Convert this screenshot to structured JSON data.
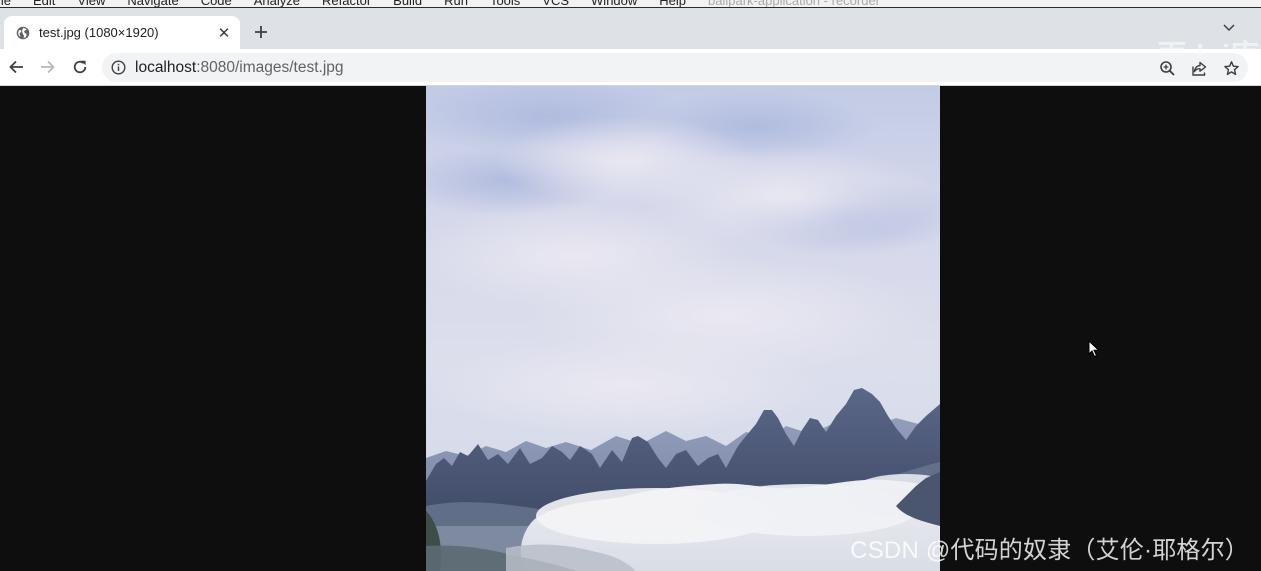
{
  "ide_menu": {
    "items": [
      "ile",
      "Edit",
      "View",
      "Navigate",
      "Code",
      "Analyze",
      "Refactor",
      "Build",
      "Run",
      "Tools",
      "VCS",
      "Window",
      "Help"
    ],
    "faint_text": "ballpark-application - recorder"
  },
  "browser": {
    "tab": {
      "title": "test.jpg (1080×1920)",
      "favicon": "globe-icon",
      "close_glyph": "✕"
    },
    "new_tab_icon": "plus-icon",
    "tab_search_icon": "chevron-down-icon",
    "nav": {
      "back_icon": "back-arrow-icon",
      "forward_icon": "forward-arrow-icon",
      "reload_icon": "reload-icon"
    },
    "address": {
      "host": "localhost",
      "rest": ":8080/images/test.jpg",
      "info_icon": "info-icon"
    },
    "actions": [
      "zoom-icon",
      "share-icon",
      "bookmark-star-icon"
    ]
  },
  "page": {
    "background": "#0e0e0e",
    "image_description_icon": "landscape-photo"
  },
  "overlays": {
    "watermark": "CSDN @代码的奴隶（艾伦·耶格尔）",
    "corner_ghost": "面dui库"
  },
  "colors": {
    "tabstrip": "#dee1e6",
    "toolbar": "#ffffff",
    "omnibox": "#f1f3f4",
    "icon": "#5f6368"
  }
}
